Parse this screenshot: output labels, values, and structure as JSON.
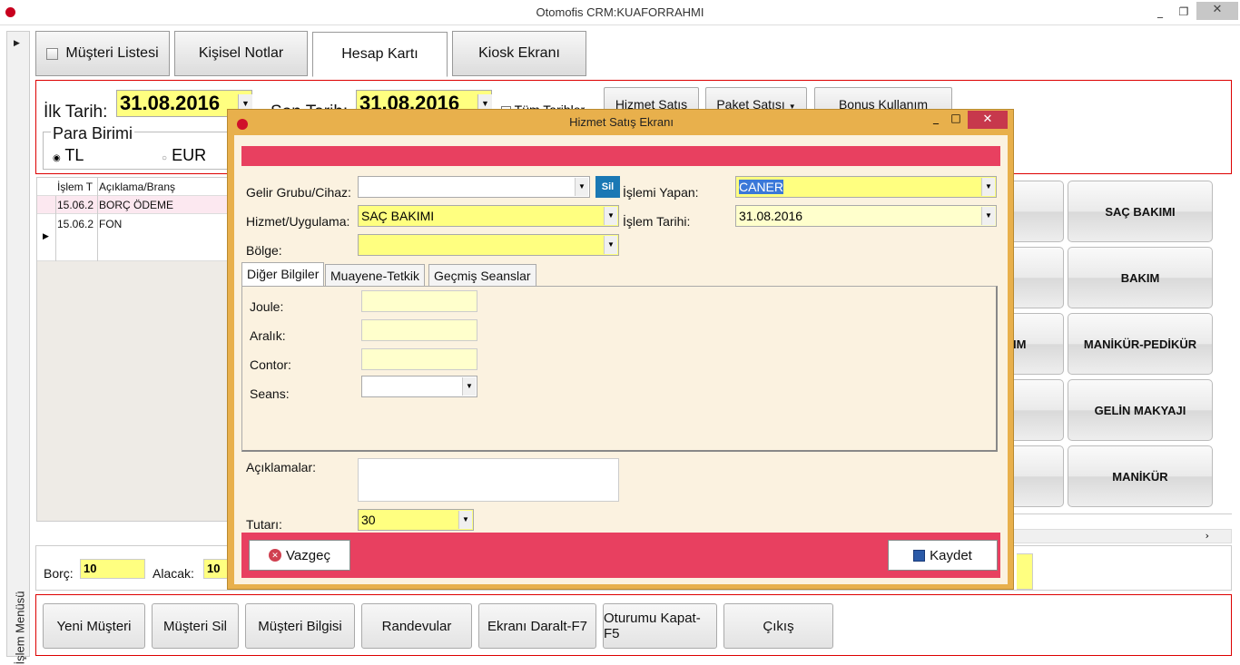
{
  "window": {
    "title": "Otomofis CRM:KUAFORRAHMI",
    "minimize": "_",
    "maximize": "❐",
    "close": "✕"
  },
  "left_menu": {
    "label": "İşlem Menüsü"
  },
  "top_tabs": [
    {
      "label": "Müşteri Listesi"
    },
    {
      "label": "Kişisel Notlar"
    },
    {
      "label": "Hesap Kartı"
    },
    {
      "label": "Kiosk Ekranı"
    }
  ],
  "filter": {
    "start_label": "İlk Tarih:",
    "start_value": "31.08.2016",
    "end_label": "Son Tarih:",
    "end_value": "31.08.2016",
    "all_dates_label": "Tüm Tarihler",
    "currency_group_label": "Para Birimi",
    "currency_tl": "TL",
    "currency_eur": "EUR",
    "btn_hizmet": "Hizmet Satış",
    "btn_paket": "Paket Satışı",
    "btn_bonus": "Bonus Kullanım"
  },
  "grid": {
    "columns": [
      "İşlem T",
      "Açıklama/Branş"
    ],
    "rows": [
      {
        "date": "15.06.2",
        "desc": "BORÇ ÖDEME"
      },
      {
        "date": "15.06.2",
        "desc": "FON"
      }
    ]
  },
  "services": [
    {
      "label": "SAÇ BAKIMI"
    },
    {
      "label": "BAKIM"
    },
    {
      "label": "MANİKÜR-PEDİKÜR"
    },
    {
      "label": "GELİN MAKYAJI"
    },
    {
      "label": "MANİKÜR"
    }
  ],
  "services_partial": {
    "label": "IM"
  },
  "info": {
    "borc_label": "Borç:",
    "borc_value": "10",
    "alacak_label": "Alacak:",
    "alacak_value": "10"
  },
  "actions": [
    {
      "label": "Yeni Müşteri"
    },
    {
      "label": "Müşteri Sil"
    },
    {
      "label": "Müşteri Bilgisi"
    },
    {
      "label": "Randevular"
    },
    {
      "label": "Ekranı Daralt-F7"
    },
    {
      "label": "Oturumu Kapat-F5"
    },
    {
      "label": "Çıkış"
    }
  ],
  "modal": {
    "title": "Hizmet Satış Ekranı",
    "gelir_label": "Gelir Grubu/Cihaz:",
    "gelir_value": "",
    "sil_label": "Sil",
    "islemi_yapan_label": "İşlemi Yapan:",
    "islemi_yapan_value": "CANER",
    "hizmet_label": "Hizmet/Uygulama:",
    "hizmet_value": "SAÇ BAKIMI",
    "islem_tarihi_label": "İşlem Tarihi:",
    "islem_tarihi_value": "31.08.2016",
    "bolge_label": "Bölge:",
    "bolge_value": "",
    "tabs": [
      {
        "label": "Diğer Bilgiler"
      },
      {
        "label": "Muayene-Tetkik"
      },
      {
        "label": "Geçmiş Seanslar"
      }
    ],
    "joule_label": "Joule:",
    "aralik_label": "Aralık:",
    "contor_label": "Contor:",
    "seans_label": "Seans:",
    "aciklamalar_label": "Açıklamalar:",
    "tutar_label": "Tutarı:",
    "tutar_value": "30",
    "cancel_label": "Vazgeç",
    "save_label": "Kaydet"
  },
  "colors": {
    "accent_red": "#e84060",
    "highlight_yellow": "#ffff80",
    "modal_frame": "#e8b04c"
  }
}
